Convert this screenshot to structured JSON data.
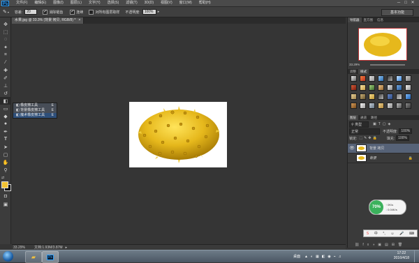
{
  "app": {
    "logo": "Ps"
  },
  "menu": [
    "文件(F)",
    "编辑(E)",
    "图像(I)",
    "图层(L)",
    "文字(Y)",
    "选择(S)",
    "滤镜(T)",
    "3D(D)",
    "视图(V)",
    "窗口(W)",
    "帮助(H)"
  ],
  "window_controls": [
    "─",
    "□",
    "✕"
  ],
  "options": {
    "tolerance_label": "容差:",
    "tolerance_value": "20",
    "antialias_label": "消除锯齿",
    "antialias_checked": true,
    "contiguous_label": "连续",
    "contiguous_checked": true,
    "all_layers_label": "对所有图层取样",
    "all_layers_checked": false,
    "opacity_label": "不透明度:",
    "opacity_value": "100%"
  },
  "workspace_button": "基本功能",
  "document": {
    "tab_label": "水果.jpg @ 33.3% (背景 拷贝, RGB/8) *",
    "tab_close": "×"
  },
  "status": {
    "zoom": "33.29%",
    "doc_size": "文档:1.93M/3.87M"
  },
  "flyout": {
    "items": [
      {
        "label": "橡皮擦工具",
        "key": "E",
        "selected": false
      },
      {
        "label": "背景橡皮擦工具",
        "key": "E",
        "selected": false
      },
      {
        "label": "魔术橡皮擦工具",
        "key": "E",
        "selected": true
      }
    ]
  },
  "panels": {
    "navigator_tabs": [
      "导航器",
      "直方图",
      "信息"
    ],
    "nav_zoom": "33.29%",
    "swatch_tabs": [
      "调整",
      "样式"
    ],
    "layer_tabs": [
      "图层",
      "通道",
      "路径"
    ],
    "layer_kind": "类型",
    "blend_mode": "正常",
    "opacity_label": "不透明度:",
    "opacity_value": "100%",
    "lock_label": "锁定:",
    "fill_label": "填充:",
    "fill_value": "100%",
    "layers": [
      {
        "name": "背景 拷贝",
        "visible": true,
        "selected": true,
        "locked": false
      },
      {
        "name": "背景",
        "visible": false,
        "selected": false,
        "locked": true
      }
    ]
  },
  "widget": {
    "percent": "70%",
    "up": "0K/s",
    "down": "0.04K/s"
  },
  "taskbar": {
    "desktop_label": "桌面",
    "time": "17:22",
    "date": "2016/4/18"
  },
  "colors": {
    "fruit": "#e6b81c",
    "fruit_dark": "#a87c05",
    "foreground": "#f2c232",
    "widget_green": "#3bb15c"
  }
}
